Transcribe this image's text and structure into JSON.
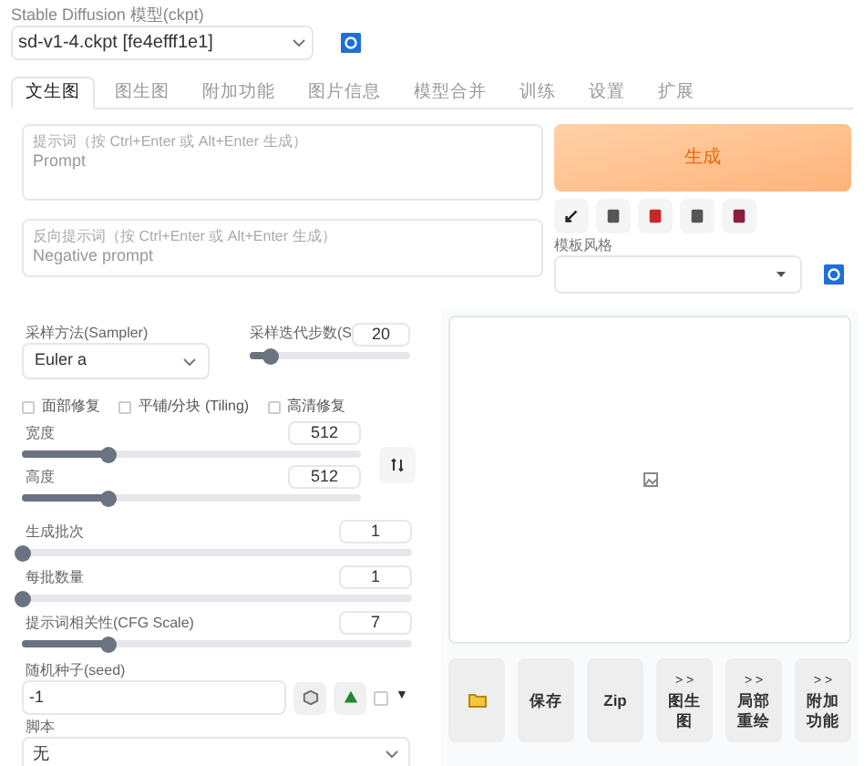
{
  "model": {
    "label": "Stable Diffusion 模型(ckpt)",
    "value": "sd-v1-4.ckpt [fe4efff1e1]"
  },
  "tabs": [
    {
      "label": "文生图",
      "selected": true
    },
    {
      "label": "图生图",
      "selected": false
    },
    {
      "label": "附加功能",
      "selected": false
    },
    {
      "label": "图片信息",
      "selected": false
    },
    {
      "label": "模型合并",
      "selected": false
    },
    {
      "label": "训练",
      "selected": false
    },
    {
      "label": "设置",
      "selected": false
    },
    {
      "label": "扩展",
      "selected": false
    }
  ],
  "prompt": {
    "label": "提示词（按 Ctrl+Enter 或 Alt+Enter 生成）",
    "placeholder": "Prompt"
  },
  "negative_prompt": {
    "label": "反向提示词（按 Ctrl+Enter 或 Alt+Enter 生成）",
    "placeholder": "Negative prompt"
  },
  "generate_button": "生成",
  "style": {
    "label": "模板风格"
  },
  "sampler": {
    "label": "采样方法(Sampler)",
    "value": "Euler a"
  },
  "steps": {
    "label": "采样迭代步数(S",
    "value": "20",
    "level": 0.13
  },
  "checkboxes": [
    {
      "label": "面部修复",
      "checked": false
    },
    {
      "label": "平铺/分块 (Tiling)",
      "checked": false
    },
    {
      "label": "高清修复",
      "checked": false
    }
  ],
  "size_sliders": [
    {
      "label": "宽度",
      "value": "512",
      "level": 0.25
    },
    {
      "label": "高度",
      "value": "512",
      "level": 0.25
    }
  ],
  "batch_sliders": [
    {
      "label": "生成批次",
      "value": "1",
      "level": 0
    },
    {
      "label": "每批数量",
      "value": "1",
      "level": 0
    },
    {
      "label": "提示词相关性(CFG Scale)",
      "value": "7",
      "level": 0.22
    }
  ],
  "seed": {
    "label": "随机种子(seed)",
    "value": "-1",
    "extra_checked": false,
    "extra_arrow": "▼"
  },
  "script": {
    "label": "脚本",
    "value": "无"
  },
  "output_buttons": [
    {
      "kind": "icon"
    },
    {
      "kind": "text",
      "label": "保存"
    },
    {
      "kind": "text",
      "label": "Zip"
    },
    {
      "kind": "send",
      "arrows": "> >",
      "label": "图生图"
    },
    {
      "kind": "send",
      "arrows": "> >",
      "label": "局部重绘"
    },
    {
      "kind": "send",
      "arrows": "> >",
      "label": "附加功能"
    }
  ]
}
